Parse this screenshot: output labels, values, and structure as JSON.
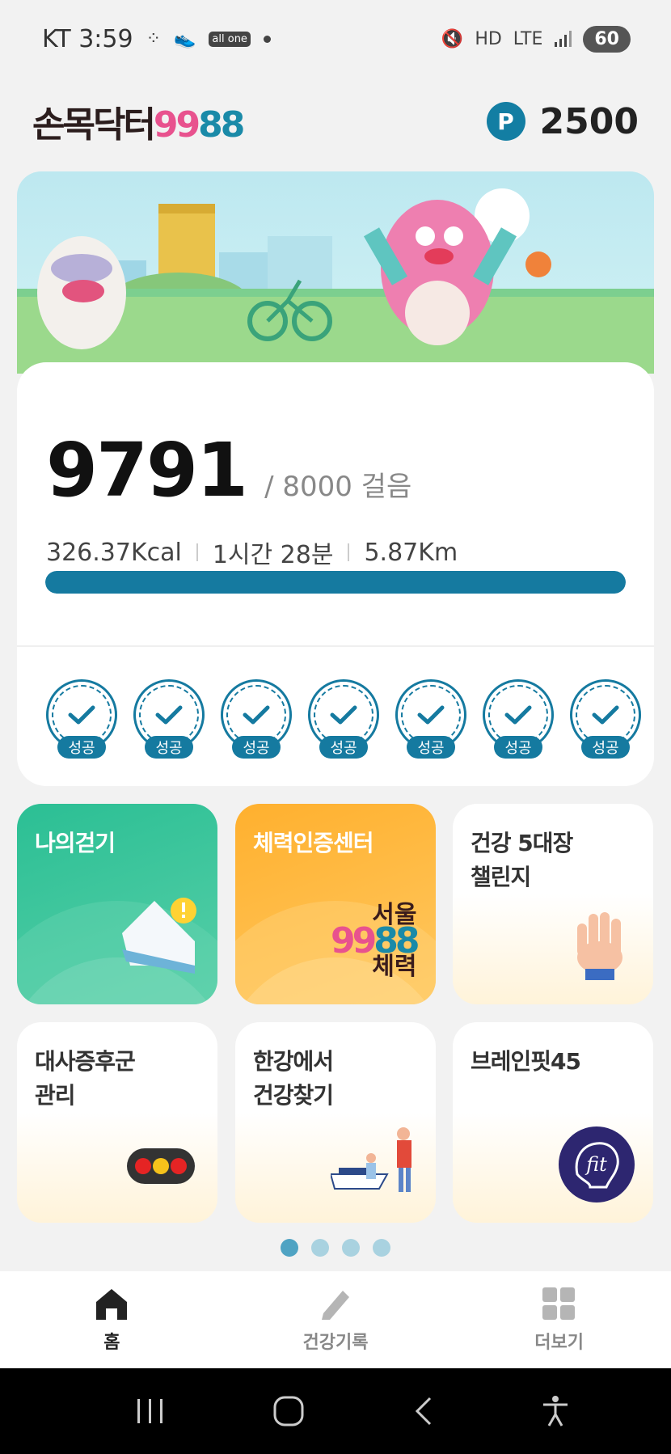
{
  "status_bar": {
    "carrier_time": "KT 3:59",
    "app_badge": "all one",
    "network": "LTE",
    "battery": "60"
  },
  "header": {
    "logo_main": "손목닥터",
    "logo_num_a": "99",
    "logo_num_b": "88",
    "points_icon": "P",
    "points_value": "2500"
  },
  "steps": {
    "count": "9791",
    "goal": "/ 8000 걸음",
    "calories": "326.37Kcal",
    "duration": "1시간 28분",
    "distance": "5.87Km",
    "progress_fraction": 1.0,
    "badges": [
      {
        "label": "성공"
      },
      {
        "label": "성공"
      },
      {
        "label": "성공"
      },
      {
        "label": "성공"
      },
      {
        "label": "성공"
      },
      {
        "label": "성공"
      },
      {
        "label": "성공"
      }
    ]
  },
  "tiles": {
    "walk": {
      "title": "나의걷기"
    },
    "fitness": {
      "title": "체력인증센터",
      "seoul": "서울",
      "num_a": "99",
      "num_b": "88",
      "body": "체력"
    },
    "health5": {
      "line1": "건강 5대장",
      "line2": "챌린지"
    },
    "metabolic": {
      "line1": "대사증후군",
      "line2": "관리"
    },
    "hangang": {
      "line1": "한강에서",
      "line2": "건강찾기"
    },
    "brainfit": {
      "title": "브레인핏45",
      "logo": "fit"
    }
  },
  "pager": {
    "count": 4,
    "active": 1
  },
  "bottom_nav": {
    "home": "홈",
    "records": "건강기록",
    "more": "더보기"
  },
  "colors": {
    "primary": "#157aa0",
    "walk_tile": "#2bbf94",
    "fitness_tile": "#ffb02e",
    "pink": "#e8528e"
  }
}
